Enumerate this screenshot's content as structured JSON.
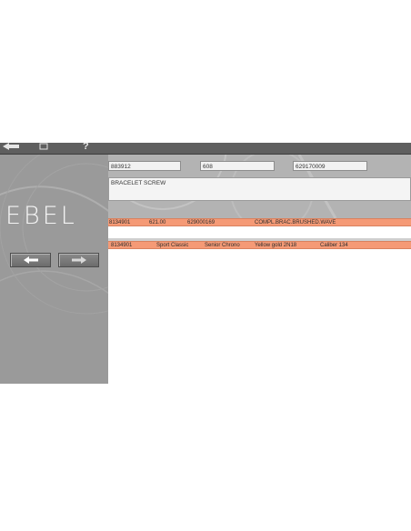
{
  "toolbar": {
    "icons": [
      "back-arrow-icon",
      "home-icon",
      "help-icon"
    ],
    "help_glyph": "?"
  },
  "brand": {
    "logo": "EBEL"
  },
  "nav": {
    "prev": "left-arrow-icon",
    "next": "right-arrow-icon"
  },
  "part": {
    "field1": "883912",
    "field2": "608",
    "field3": "629170009",
    "description": "BRACELET SCREW"
  },
  "bracelet_row": [
    "8134901",
    "621.00",
    "629000169",
    "COMPL.BRAC.BRUSHED.WAVE"
  ],
  "model_row": [
    "8134901",
    "Sport Classic",
    "Senior Chrono",
    "Yellow gold 2N18",
    "Caliber 134"
  ],
  "colors": {
    "accent": "#f59a76",
    "panel": "#9a9a9a",
    "toolbar": "#5f5f5f"
  }
}
